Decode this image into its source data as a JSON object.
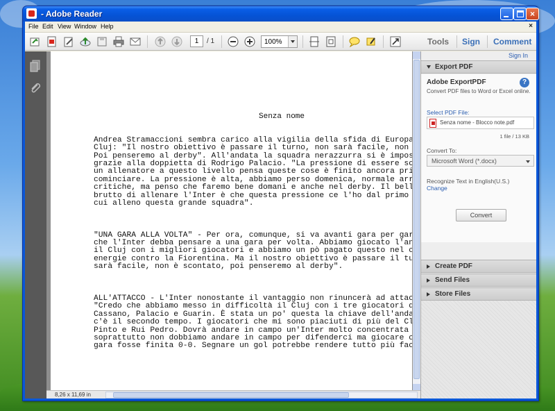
{
  "window": {
    "title": "- Adobe Reader",
    "controls": {
      "minimize": "minimize",
      "maximize": "maximize",
      "close": "×"
    }
  },
  "menubar": {
    "items": [
      "File",
      "Edit",
      "View",
      "Window",
      "Help"
    ],
    "close_doc": "×"
  },
  "toolbar": {
    "page_current": "1",
    "page_total": "/ 1",
    "zoom": "100%",
    "links": {
      "tools": "Tools",
      "sign": "Sign",
      "comment": "Comment"
    }
  },
  "document": {
    "title": "Senza nome",
    "paragraphs": [
      [
        "Andrea Stramaccioni sembra carico alla vigilia della sfida di Europa",
        "Cluj: \"Il nostro obiettivo è passare il turno, non sarà facile, non",
        "Poi penseremo al derby\". All'andata la squadra nerazzurra si è impost",
        "grazie alla doppietta di Rodrigo Palacio. \"La pressione di essere so",
        "un allenatore a questo livello pensa queste cose è finito ancora prim",
        "cominciare. La pressione è alta, abbiamo perso domenica, normale arri",
        "critiche, ma penso che faremo bene domani e anche nel derby. Il bello",
        "brutto di allenare l'Inter è che questa pressione ce l'ho dal primo g",
        "cui alleno questa grande squadra\"."
      ],
      [
        "\"UNA GARA ALLA VOLTA\" - Per ora, comunque, si va avanti gara per gar",
        "che l'Inter debba pensare a una gara per volta. Abbiamo giocato l'and",
        "il Cluj con i migliori giocatori e abbiamo un pò pagato questo nel co",
        "energie contro la Fiorentina. Ma il nostro obiettivo è passare il tu",
        "sarà facile, non è scontato, poi penseremo al derby\"."
      ],
      [
        "ALL'ATTACCO - L'Inter nonostante il vantaggio non rinuncerà ad attac",
        "\"Credo che abbiamo messo in difficoltà il Cluj con i tre giocatori d",
        "Cassano, Palacio e Guarin. È stata un po' questa la chiave dell'andat",
        "c'è il secondo tempo. I giocatori che mi sono piaciuti di più del Cl",
        "Pinto e Rui Pedro. Dovrà andare in campo un'Inter molto concentrata e",
        "soprattutto non dobbiamo andare in campo per difenderci ma giocare co",
        "gara fosse finita 0-0. Segnare un gol potrebbe rendere tutto più faci"
      ]
    ]
  },
  "statusbar": {
    "page_size": "8,26 x 11,69 in"
  },
  "panel": {
    "sign_in": "Sign In",
    "sections": {
      "export": "Export PDF",
      "create": "Create PDF",
      "send": "Send Files",
      "store": "Store Files"
    },
    "export": {
      "title": "Adobe ExportPDF",
      "description": "Convert PDF files to Word or Excel online.",
      "help": "?",
      "select_label": "Select PDF File:",
      "file_name": "Senza nome - Blocco note.pdf",
      "file_meta": "1 file / 13 KB",
      "convert_to_label": "Convert To:",
      "convert_to_value": "Microsoft Word (*.docx)",
      "recognize_label": "Recognize Text in English(U.S.)",
      "change_link": "Change",
      "convert_button": "Convert"
    }
  }
}
